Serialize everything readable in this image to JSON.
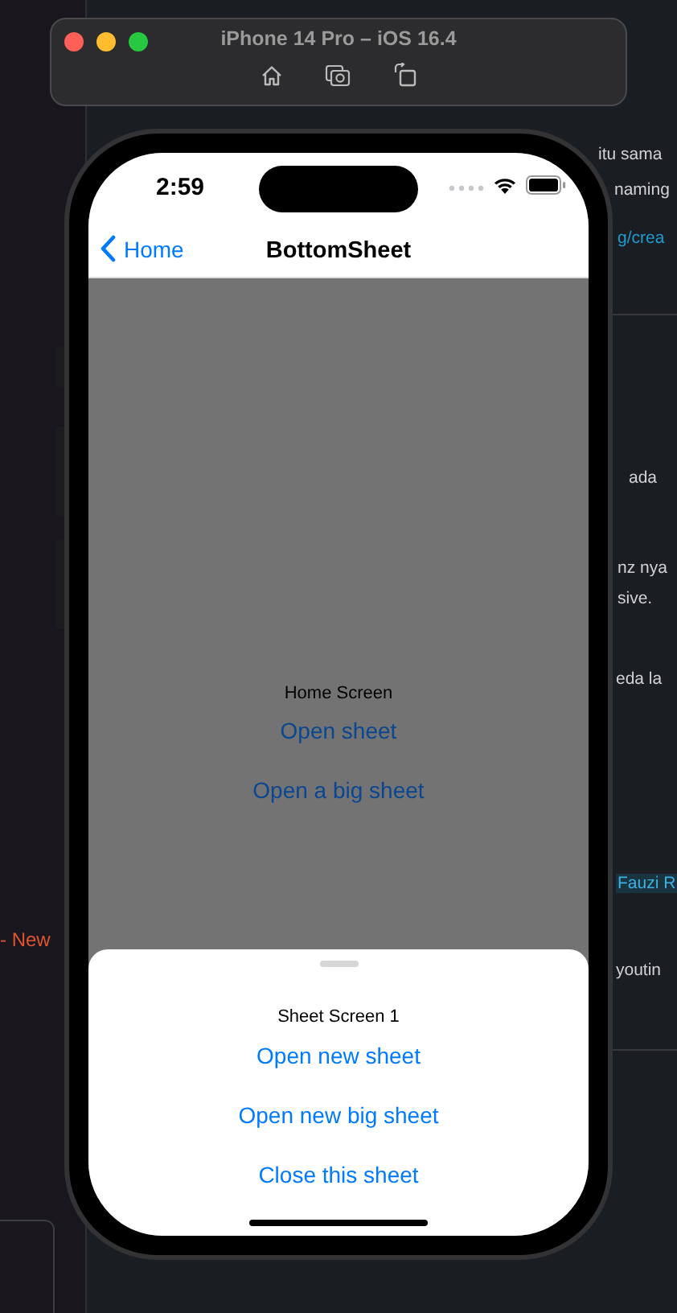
{
  "simulator": {
    "title": "iPhone 14 Pro – iOS 16.4"
  },
  "phone": {
    "status_bar": {
      "time": "2:59"
    },
    "nav_bar": {
      "back": "Home",
      "title": "BottomSheet"
    },
    "home_screen": {
      "label": "Home Screen",
      "buttons": [
        "Open sheet",
        "Open a big sheet"
      ]
    },
    "sheet": {
      "title": "Sheet Screen 1",
      "buttons": [
        "Open new sheet",
        "Open new big sheet",
        "Close this sheet"
      ]
    }
  },
  "background": {
    "sidebar_label": "- New",
    "messages": [
      {
        "text": "itu sama",
        "kind": "text"
      },
      {
        "text": "naming",
        "kind": "text"
      },
      {
        "text": "g/crea",
        "kind": "link"
      },
      {
        "text": "ada",
        "kind": "text"
      },
      {
        "text": "nz nya",
        "kind": "text"
      },
      {
        "text": "sive.",
        "kind": "text"
      },
      {
        "text": "eda la",
        "kind": "text"
      },
      {
        "text": "Fauzi R",
        "kind": "mention"
      },
      {
        "text": "youtin",
        "kind": "text"
      }
    ]
  }
}
